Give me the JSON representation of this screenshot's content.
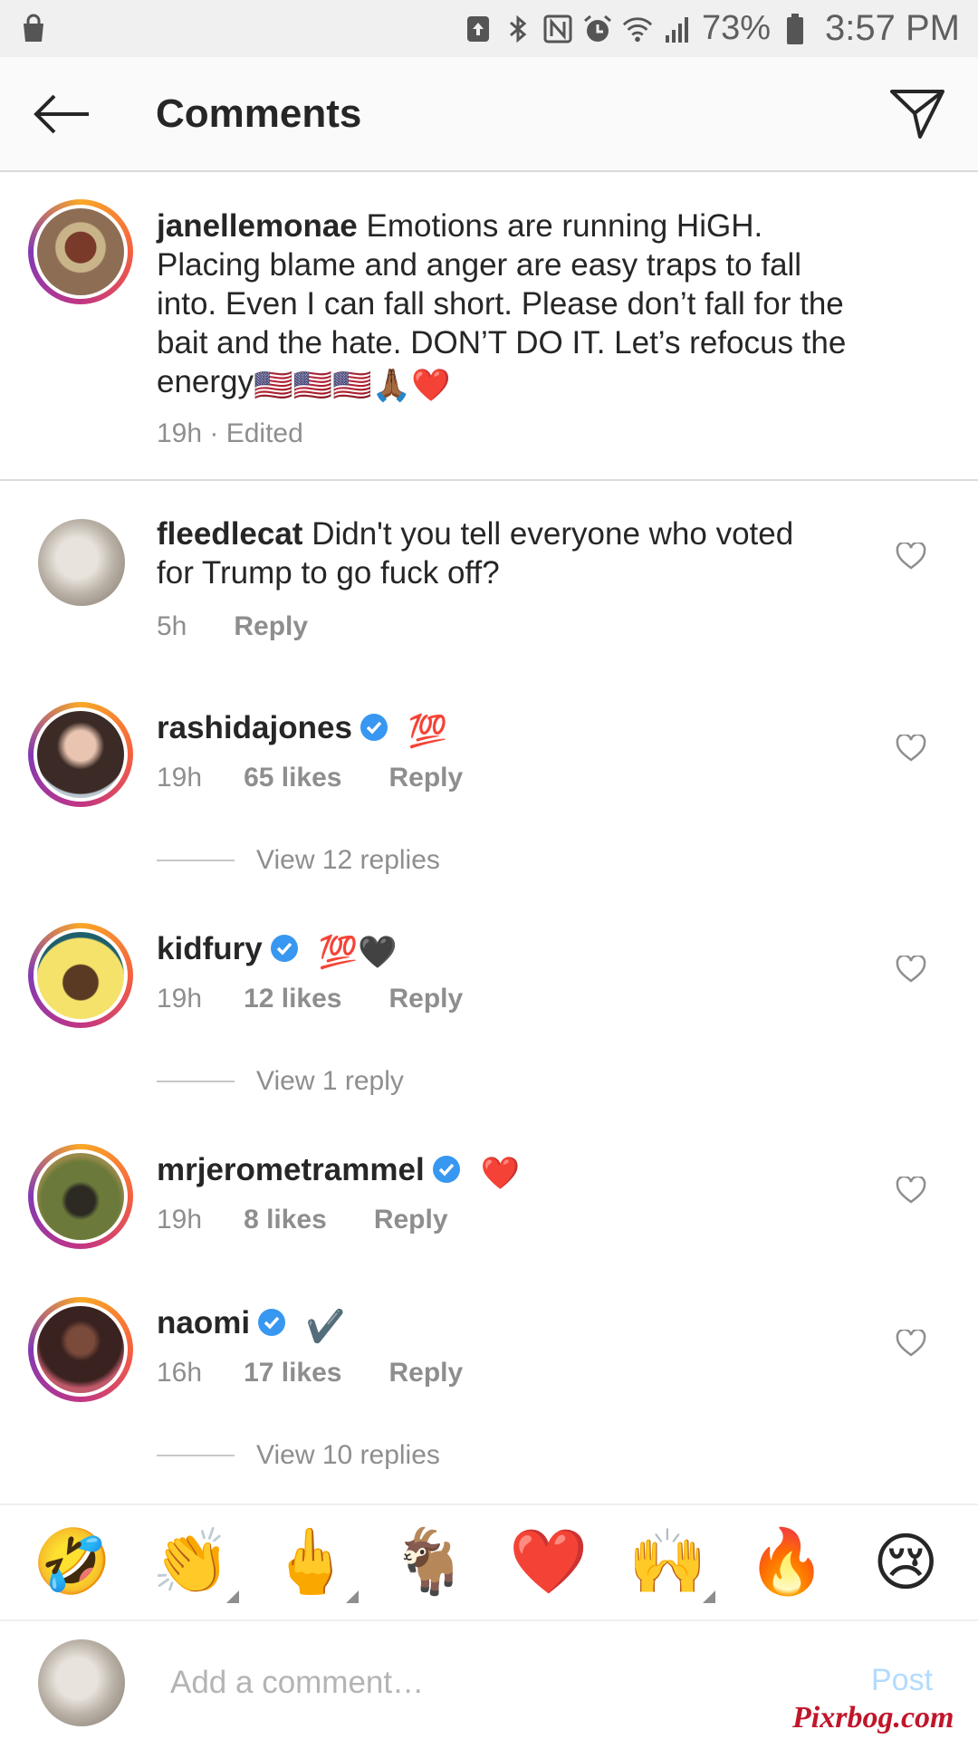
{
  "status_bar": {
    "battery_percent": "73%",
    "time": "3:57 PM",
    "icons": [
      "shopping-bag-icon",
      "upload-icon",
      "bluetooth-icon",
      "nfc-icon",
      "alarm-icon",
      "wifi-icon",
      "signal-icon",
      "battery-icon"
    ]
  },
  "header": {
    "title": "Comments",
    "back_icon": "arrow-left-icon",
    "share_icon": "paper-plane-icon"
  },
  "caption": {
    "username": "janellemonae",
    "lines": [
      "Emotions are running HiGH.",
      "Placing blame and anger are easy traps to fall",
      "into. Even I can fall short. Please don’t fall for the",
      "bait and the hate. DON’T DO IT. Let’s refocus the",
      "energy"
    ],
    "emojis": "🇺🇸🇺🇸🇺🇸🙏🏾❤️",
    "meta": "19h · Edited"
  },
  "comments": [
    {
      "username": "fleedlecat",
      "verified": false,
      "text_line1": "Didn't you tell everyone who voted",
      "text_line2": "for Trump to go fuck off?",
      "time": "5h",
      "likes": "",
      "reply_label": "Reply",
      "view_replies": ""
    },
    {
      "username": "rashidajones",
      "verified": true,
      "text": "💯",
      "time": "19h",
      "likes": "65 likes",
      "reply_label": "Reply",
      "view_replies": "View 12 replies"
    },
    {
      "username": "kidfury",
      "verified": true,
      "text": "💯🖤",
      "time": "19h",
      "likes": "12 likes",
      "reply_label": "Reply",
      "view_replies": "View 1 reply"
    },
    {
      "username": "mrjerometrammel",
      "verified": true,
      "text": "❤️",
      "time": "19h",
      "likes": "8 likes",
      "reply_label": "Reply",
      "view_replies": ""
    },
    {
      "username": "naomi",
      "verified": true,
      "text": "✔️",
      "time": "16h",
      "likes": "17 likes",
      "reply_label": "Reply",
      "view_replies": "View 10 replies"
    }
  ],
  "emoji_bar": [
    "🤣",
    "👏",
    "🖕",
    "🐐",
    "❤️",
    "🙌",
    "🔥",
    "😢"
  ],
  "input": {
    "placeholder": "Add a comment…",
    "post_label": "Post"
  },
  "watermark": "Pixrbog.com",
  "colors": {
    "verified_blue": "#3897f0",
    "secondary_text": "#8e8e8e",
    "post_disabled": "#b3dbff",
    "story_ring": "#c13584"
  }
}
